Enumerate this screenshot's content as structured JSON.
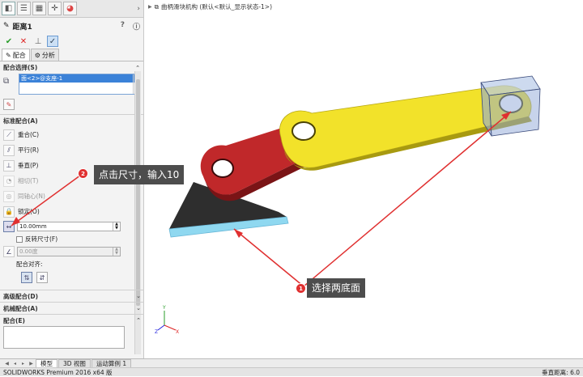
{
  "panel": {
    "title": "距离1",
    "tabs": [
      {
        "label": "配合"
      },
      {
        "label": "分析"
      }
    ],
    "selection_header": "配合选择(S)",
    "selection_item": "面<2>@支座-1",
    "standard_header": "标准配合(A)",
    "mates": [
      {
        "label": "重合(C)"
      },
      {
        "label": "平行(R)"
      },
      {
        "label": "垂直(P)"
      },
      {
        "label": "相切(T)"
      },
      {
        "label": "同轴心(N)"
      },
      {
        "label": "锁定(O)"
      }
    ],
    "distance_value": "10.00mm",
    "flip_label": "反转尺寸(F)",
    "angle_value": "0.00度",
    "align_label": "配合对齐:",
    "advanced_header": "高级配合(D)",
    "mechanical_header": "机械配合(A)",
    "notes_header": "配合(E)"
  },
  "document": {
    "title": "曲柄滑块机构 (默认<默认_显示状态-1>)"
  },
  "annotations": {
    "callout1_text": "选择两底面",
    "callout1_num": "1",
    "callout2_text": "点击尺寸，输入10",
    "callout2_num": "2",
    "annotation_color": "#e03030"
  },
  "bottom_tabs": [
    "模型",
    "3D 视图",
    "运动算例 1"
  ],
  "status": {
    "left": "SOLIDWORKS Premium 2016 x64 版",
    "right": "垂直距离: 6.0"
  },
  "colors": {
    "crank": "#c0282a",
    "rod": "#f2e22a",
    "block": "#8fa8d8",
    "base": "#2e2e2e",
    "base_highlight": "#8fd8f0"
  }
}
